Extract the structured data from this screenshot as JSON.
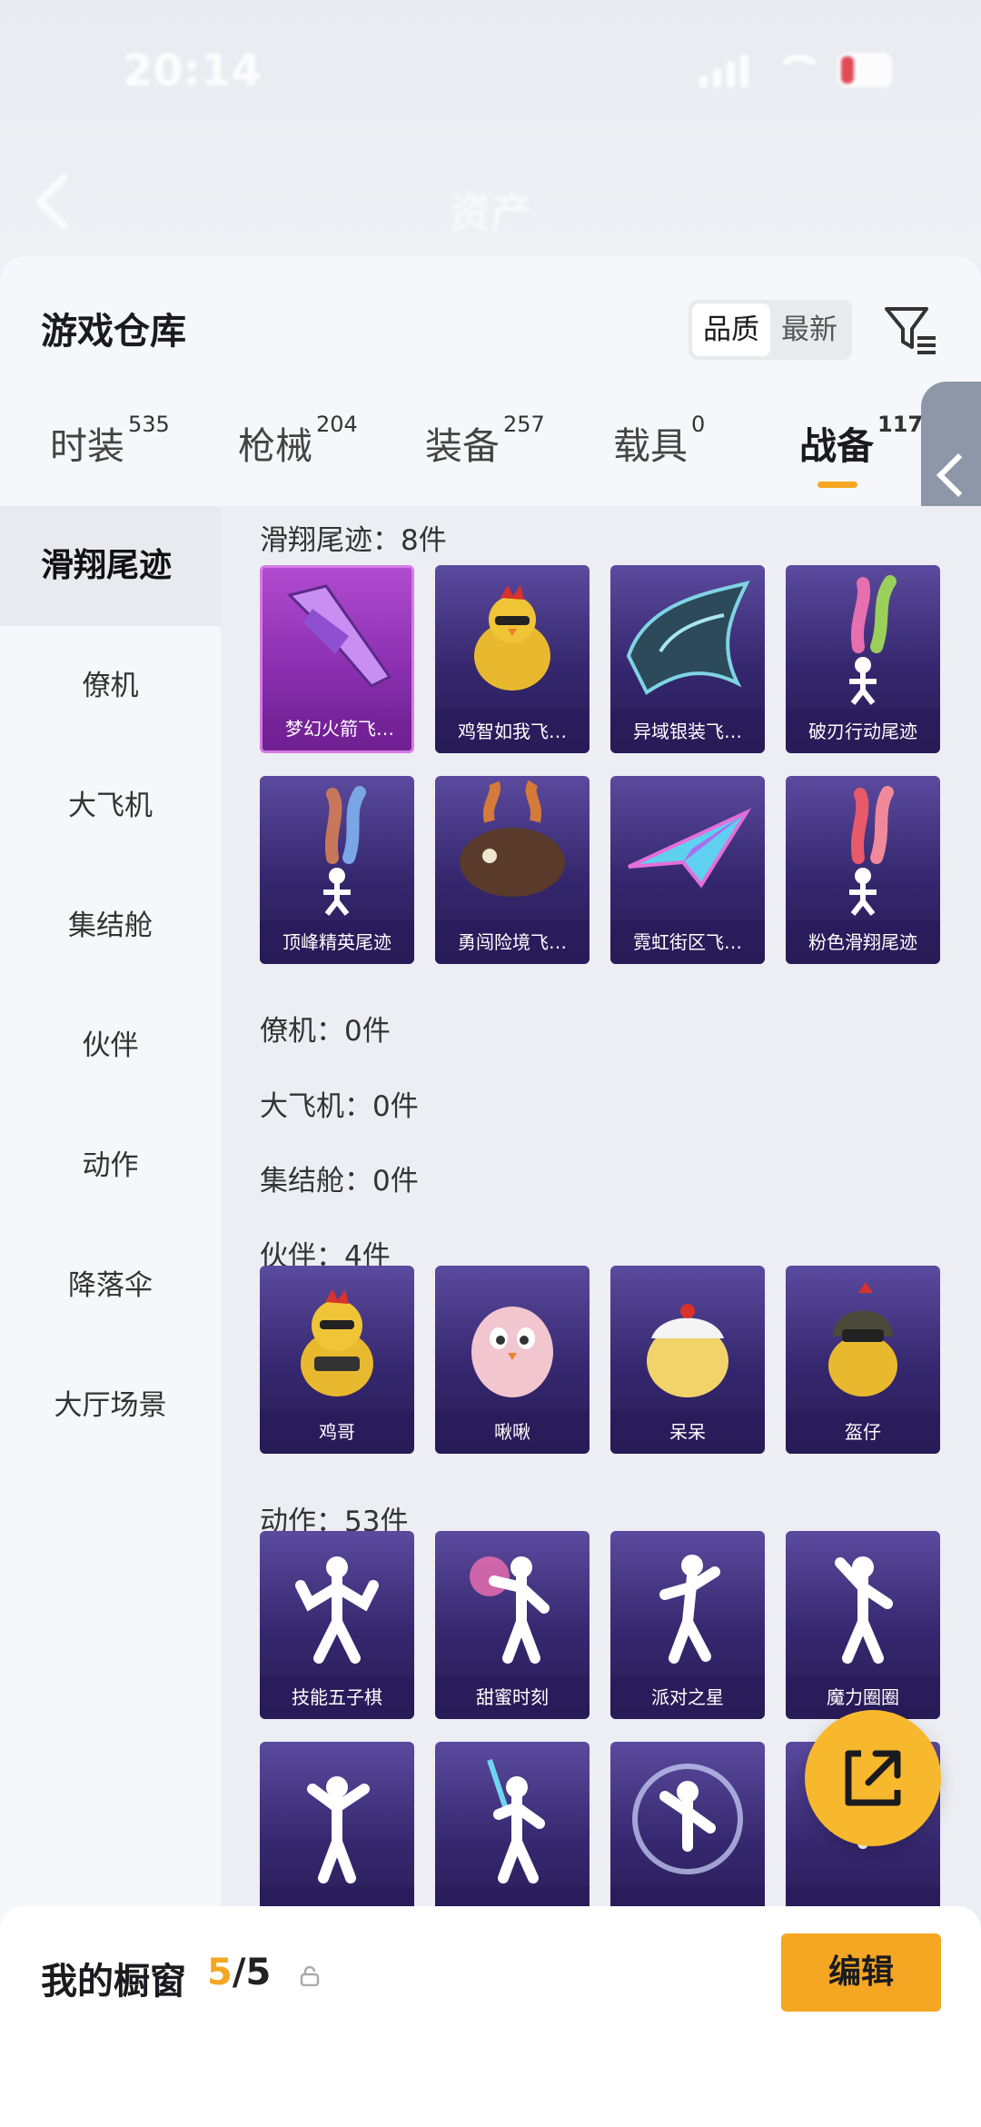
{
  "status": {
    "time": "20:14"
  },
  "nav": {
    "title": "资产"
  },
  "header": {
    "title": "游戏仓库",
    "sort": [
      "品质",
      "最新"
    ]
  },
  "tabs": [
    {
      "label": "时装",
      "count": "535"
    },
    {
      "label": "枪械",
      "count": "204"
    },
    {
      "label": "装备",
      "count": "257"
    },
    {
      "label": "载具",
      "count": "0"
    },
    {
      "label": "战备",
      "count": "117"
    }
  ],
  "sidebar": {
    "items": [
      "滑翔尾迹",
      "僚机",
      "大飞机",
      "集结舱",
      "伙伴",
      "动作",
      "降落伞",
      "大厅场景"
    ]
  },
  "sections": {
    "trail": {
      "label": "滑翔尾迹：8件"
    },
    "wingman": {
      "label": "僚机：0件"
    },
    "plane": {
      "label": "大飞机：0件"
    },
    "pod": {
      "label": "集结舱：0件"
    },
    "buddy": {
      "label": "伙伴：4件"
    },
    "emote": {
      "label": "动作：53件"
    }
  },
  "cards": {
    "trail": [
      "梦幻火箭飞…",
      "鸡智如我飞…",
      "异域银装飞…",
      "破刃行动尾迹",
      "顶峰精英尾迹",
      "勇闯险境飞…",
      "霓虹街区飞…",
      "粉色滑翔尾迹"
    ],
    "buddy": [
      "鸡哥",
      "啾啾",
      "呆呆",
      "盔仔"
    ],
    "emote": [
      "技能五子棋",
      "甜蜜时刻",
      "派对之星",
      "魔力圈圈",
      "",
      "",
      "",
      ""
    ]
  },
  "bottom": {
    "label": "我的橱窗",
    "count_current": "5",
    "count_total": "/5",
    "edit": "编辑"
  },
  "colors": {
    "accent": "#f5a623",
    "card": "#3a2c78",
    "card_pink": "#a03fc4"
  },
  "icons": [
    "back-icon",
    "filter-icon",
    "collapse-icon",
    "lock-icon",
    "share-icon"
  ]
}
